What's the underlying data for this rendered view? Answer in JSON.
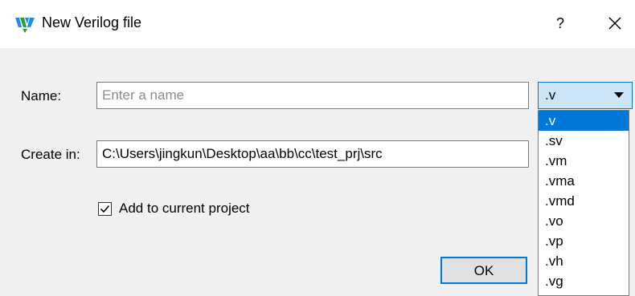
{
  "window": {
    "title": "New Verilog file",
    "help_label": "?"
  },
  "form": {
    "name_label": "Name:",
    "name_placeholder": "Enter a name",
    "name_value": "",
    "create_in_label": "Create in:",
    "create_in_value": "C:\\Users\\jingkun\\Desktop\\aa\\bb\\cc\\test_prj\\src",
    "extension_selected": ".v",
    "extension_options": [
      ".v",
      ".sv",
      ".vm",
      ".vma",
      ".vmd",
      ".vo",
      ".vp",
      ".vh",
      ".vg"
    ],
    "add_to_project_label": "Add to current project",
    "add_to_project_checked": true
  },
  "buttons": {
    "ok_label": "OK"
  },
  "colors": {
    "accent": "#0078d7",
    "combo_bg": "#cce4f7"
  },
  "icons": {
    "app": "gowin-logo-icon",
    "close": "close-icon",
    "dropdown": "chevron-down-icon",
    "check": "checkmark-icon"
  }
}
